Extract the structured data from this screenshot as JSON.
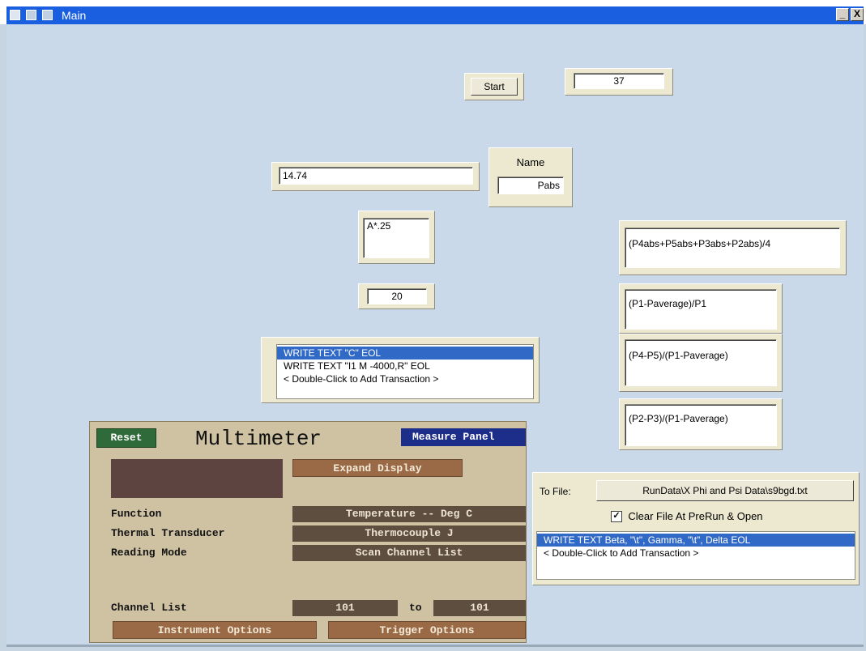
{
  "window": {
    "title": "Main",
    "minimize_label": "_",
    "close_label": "X"
  },
  "start": {
    "label": "Start",
    "value": "37"
  },
  "input_1": {
    "value": "14.74"
  },
  "name_box": {
    "label": "Name",
    "value": "Pabs"
  },
  "formula_box": {
    "value": "A*.25"
  },
  "value_20": {
    "value": "20"
  },
  "expressions": [
    "(P4abs+P5abs+P3abs+P2abs)/4",
    "(P1-Paverage)/P1",
    "(P4-P5)/(P1-Paverage)",
    "(P2-P3)/(P1-Paverage)"
  ],
  "io_transactions": [
    "WRITE TEXT \"C\" EOL",
    "WRITE TEXT \"I1 M -4000,R\" EOL",
    "< Double-Click to Add Transaction >"
  ],
  "to_file": {
    "label": "To File:",
    "path": "RunData\\X Phi and Psi Data\\s9bgd.txt",
    "checkbox_label": "Clear File At PreRun & Open",
    "checked": true,
    "transactions": [
      "WRITE TEXT Beta, \"\\t\", Gamma, \"\\t\", Delta EOL",
      "< Double-Click to Add Transaction >"
    ]
  },
  "multimeter": {
    "reset_label": "Reset",
    "title": "Multimeter",
    "measure_label": "Measure Panel",
    "expand_label": "Expand Display",
    "function_label": "Function",
    "function_value": "Temperature -- Deg C",
    "transducer_label": "Thermal Transducer",
    "transducer_value": "Thermocouple J",
    "mode_label": "Reading Mode",
    "mode_value": "Scan Channel List",
    "channel_label": "Channel List",
    "channel_from": "101",
    "channel_to_label": "to",
    "channel_to": "101",
    "instrument_options_label": "Instrument Options",
    "trigger_options_label": "Trigger Options"
  },
  "colors": {
    "titlebar": "#1a5fe0",
    "workspace": "#c9d9e9",
    "selection": "#3169c6",
    "multimeter_bg": "#cfc2a3"
  }
}
